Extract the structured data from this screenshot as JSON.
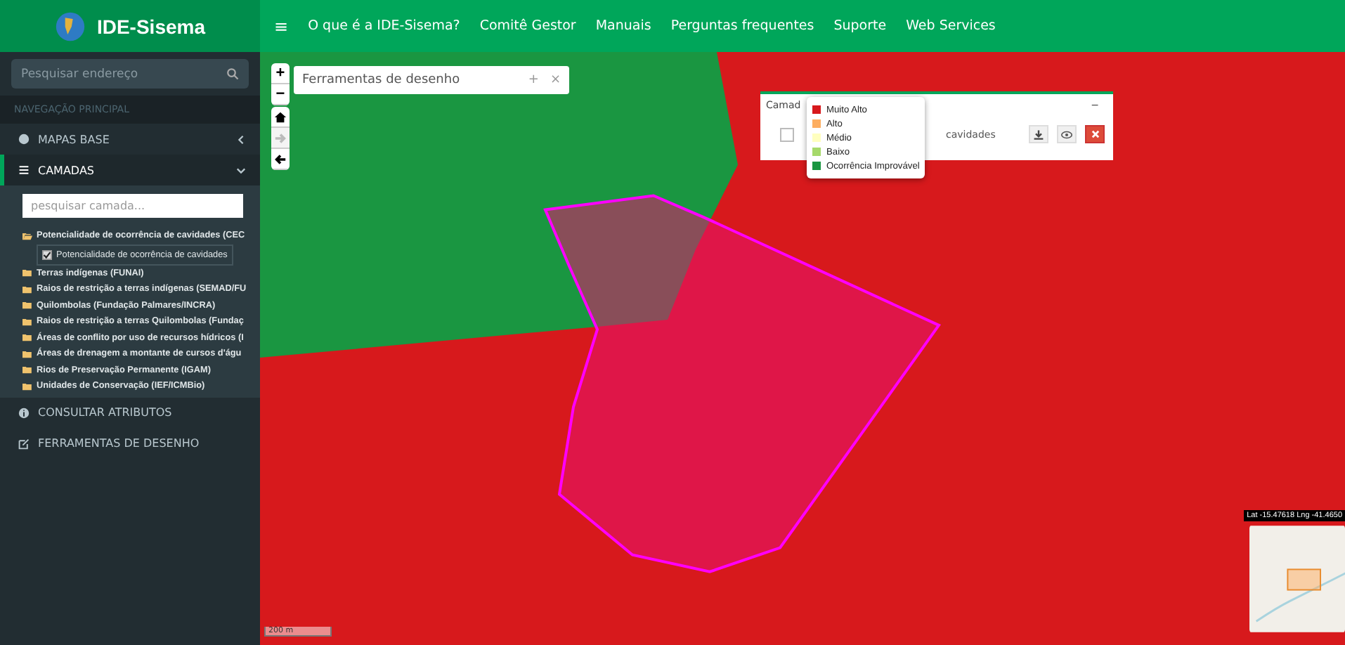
{
  "brand": {
    "title": "IDE-Sisema"
  },
  "top_nav": {
    "menu_icon": "≡",
    "links": [
      "O que é a IDE-Sisema?",
      "Comitê Gestor",
      "Manuais",
      "Perguntas frequentes",
      "Suporte",
      "Web Services"
    ]
  },
  "sidebar": {
    "search": {
      "placeholder": "Pesquisar endereço"
    },
    "section_header": "NAVEGAÇÃO PRINCIPAL",
    "items": [
      {
        "label": "MAPAS BASE",
        "kind": "globe",
        "selected": false,
        "expanded": false
      },
      {
        "label": "CAMADAS",
        "kind": "list",
        "selected": true,
        "expanded": true
      },
      {
        "label": "CONSULTAR ATRIBUTOS",
        "kind": "info",
        "selected": false
      },
      {
        "label": "FERRAMENTAS DE DESENHO",
        "kind": "edit",
        "selected": false
      }
    ],
    "layer_search": {
      "placeholder": "pesquisar camada..."
    },
    "layer_tree": [
      {
        "label": "Potencialidade de ocorrência de cavidades (CEC",
        "expanded": true,
        "children": [
          {
            "label": "Potencialidade de ocorrência de cavidades",
            "checked": true
          }
        ]
      },
      {
        "label": "Terras indígenas (FUNAI)",
        "expanded": false
      },
      {
        "label": "Raios de restrição a terras indígenas (SEMAD/FU",
        "expanded": false
      },
      {
        "label": "Quilombolas (Fundação Palmares/INCRA)",
        "expanded": false
      },
      {
        "label": "Raios de restrição a terras Quilombolas (Fundaç",
        "expanded": false
      },
      {
        "label": "Áreas de conflito por uso de recursos hídricos (I",
        "expanded": false
      },
      {
        "label": "Áreas de drenagem a montante de cursos d'águ",
        "expanded": false
      },
      {
        "label": "Rios de Preservação Permanente (IGAM)",
        "expanded": false
      },
      {
        "label": "Unidades de Conservação (IEF/ICMBio)",
        "expanded": false
      }
    ]
  },
  "map": {
    "zoom": [
      "+",
      "−"
    ],
    "history": [
      {
        "kind": "home",
        "disabled": false
      },
      {
        "kind": "forward",
        "disabled": true
      },
      {
        "kind": "back",
        "disabled": false
      }
    ],
    "draw_tools": {
      "title": "Ferramentas de desenho",
      "add": "+",
      "close": "×"
    },
    "layers_panel": {
      "title": "Camad",
      "collapse": "−",
      "layer_name": "cavidades"
    },
    "legend": [
      {
        "label": "Muito Alto",
        "color": "#d7191c"
      },
      {
        "label": "Alto",
        "color": "#fdae61"
      },
      {
        "label": "Médio",
        "color": "#ffffbf"
      },
      {
        "label": "Baixo",
        "color": "#a6d96a"
      },
      {
        "label": "Ocorrência Improvável",
        "color": "#1a9641"
      }
    ],
    "coordinates": "Lat -15.47618 Lng -41.4650",
    "scale": "200 m"
  }
}
